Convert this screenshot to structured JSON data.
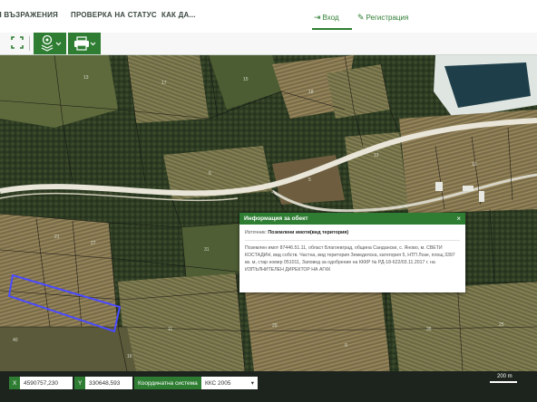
{
  "header": {
    "nav": [
      {
        "label": "Я ВЪЗРАЖЕНИЯ"
      },
      {
        "label": "ПРОВЕРКА НА СТАТУС"
      },
      {
        "label": "КАК ДА..."
      }
    ],
    "login_label": "Вход",
    "register_label": "Регистрация"
  },
  "toolbar": {
    "icons": [
      "expand-icon",
      "layers-icon",
      "print-icon"
    ]
  },
  "popup": {
    "title": "Информация за обект",
    "close": "×",
    "source_label": "Източник:",
    "source_value": "Поземлени имоти(вид територия)",
    "body": "Поземлен имот 87446.51.11, област Благоевград, община Сандански, с. Яново, м. СВЕТИ КОСТАДИН, вид собств. Частна, вид територия Земеделска, категория 5, НТП Лозе, площ 3397 кв. м, стар номер 051011, Заповед за одобрение на КККР № РД-18-622/03.11.2017 г. на ИЗПЪЛНИТЕЛЕН ДИРЕКТОР НА АГКК"
  },
  "map": {
    "parcel_labels": [
      "13",
      "17",
      "15",
      "18",
      "12",
      "10",
      "6",
      "5",
      "21",
      "27",
      "31",
      "40",
      "11",
      "29",
      "9",
      "35",
      "25",
      "23",
      "7",
      "16"
    ],
    "scale_label": "200 m"
  },
  "statusbar": {
    "x_label": "X",
    "x_value": "4590757,230",
    "y_label": "Y",
    "y_value": "330648,593",
    "crs_label": "Координатна система",
    "crs_value": "ККС 2005",
    "crs_caret": "▾"
  },
  "colors": {
    "accent": "#2e7d32",
    "parcel_highlight": "#4b4bff"
  }
}
